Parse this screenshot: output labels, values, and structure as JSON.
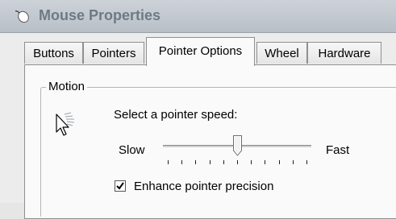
{
  "window": {
    "title": "Mouse Properties",
    "icon": "mouse-icon"
  },
  "tabs": [
    {
      "label": "Buttons",
      "active": false
    },
    {
      "label": "Pointers",
      "active": false
    },
    {
      "label": "Pointer Options",
      "active": true
    },
    {
      "label": "Wheel",
      "active": false
    },
    {
      "label": "Hardware",
      "active": false
    }
  ],
  "motion": {
    "group_label": "Motion",
    "icon": "pointer-speed-icon",
    "prompt": "Select a pointer speed:",
    "slow_label": "Slow",
    "fast_label": "Fast",
    "speed_fraction": 0.5,
    "tick_count": 11,
    "enhance_precision": {
      "label": "Enhance pointer precision",
      "checked": true
    }
  }
}
